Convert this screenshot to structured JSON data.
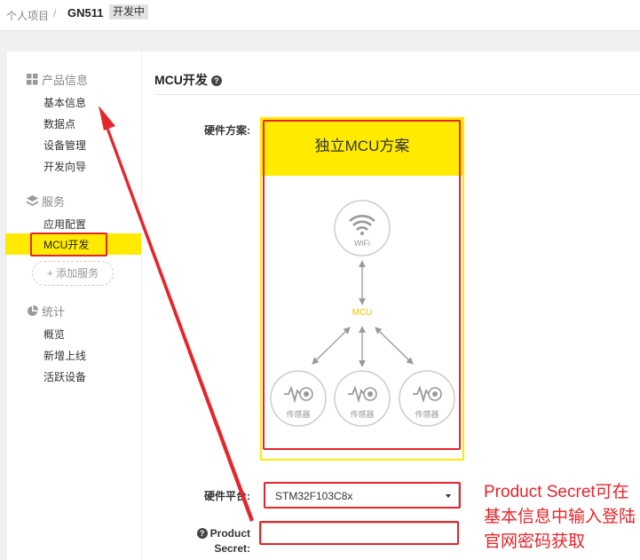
{
  "breadcrumb": {
    "home": "个人项目",
    "separator": "/",
    "current": "GN511",
    "status": "开发中"
  },
  "sidebar": {
    "sections": [
      {
        "title": "产品信息",
        "icon": "grid-icon",
        "items": [
          "基本信息",
          "数据点",
          "设备管理",
          "开发向导"
        ]
      },
      {
        "title": "服务",
        "icon": "layers-icon",
        "items": [
          "应用配置",
          "MCU开发"
        ],
        "add_label": "+ 添加服务"
      },
      {
        "title": "统计",
        "icon": "pie-chart-icon",
        "items": [
          "概览",
          "新增上线",
          "活跃设备"
        ]
      }
    ],
    "active_item": "MCU开发"
  },
  "main": {
    "title": "MCU开发",
    "help_icon": "question-circle-icon",
    "hardware_scheme_label": "硬件方案:",
    "card": {
      "title": "独立MCU方案",
      "wifi_label": "WiFi",
      "mcu_label": "MCU",
      "sensor_label": "传感器",
      "accent": "#ffea00"
    },
    "platform_label": "硬件平台:",
    "platform_value": "STM32F103C8x",
    "product_secret_label": "Product",
    "product_secret_label2": "Secret:",
    "product_secret_value": ""
  },
  "annotation": {
    "note": "Product Secret可在基本信息中输入登陆官网密码获取",
    "color": "#e5252a"
  }
}
